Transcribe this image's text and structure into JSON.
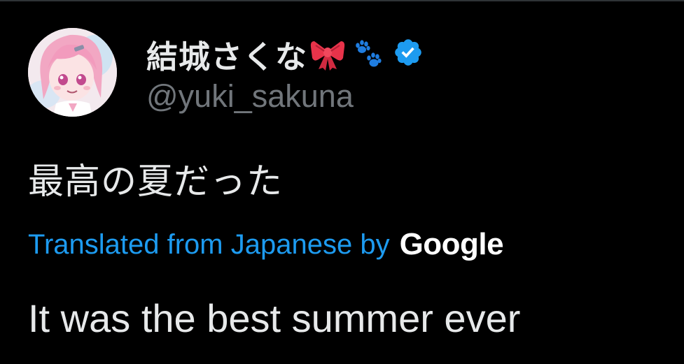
{
  "author": {
    "display_name": "結城さくな",
    "handle": "@yuki_sakuna",
    "name_emojis": [
      "ribbon-icon",
      "paw-prints-icon"
    ],
    "verified": true,
    "verified_color": "#1d9bf0",
    "avatar": "anime-girl-pink-hair-avatar"
  },
  "tweet": {
    "text": "最高の夏だった",
    "translation_label": "Translated from Japanese by",
    "translation_provider": "Google",
    "translated_text": "It was the best summer ever"
  },
  "colors": {
    "background": "#000000",
    "primary_text": "#e7e9ea",
    "secondary_text": "#71767b",
    "link": "#1d9bf0"
  }
}
